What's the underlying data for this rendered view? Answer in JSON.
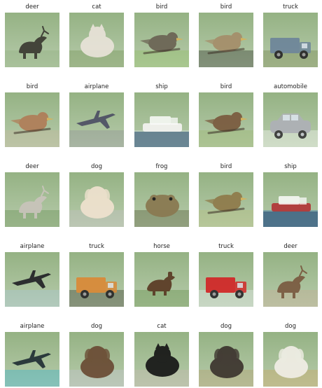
{
  "images": [
    {
      "label": "deer",
      "subject": "deer",
      "bg": "#8fae7d",
      "fg": "#3b3a32"
    },
    {
      "label": "cat",
      "subject": "cat",
      "bg": "#6f8f4c",
      "fg": "#e9e3d9"
    },
    {
      "label": "bird",
      "subject": "bird",
      "bg": "#8fbf5f",
      "fg": "#6b6354"
    },
    {
      "label": "bird",
      "subject": "bird",
      "bg": "#23251f",
      "fg": "#a58e6a"
    },
    {
      "label": "truck",
      "subject": "truck",
      "bg": "#6f7e42",
      "fg": "#6f879a"
    },
    {
      "label": "bird",
      "subject": "bird",
      "bg": "#c8b79e",
      "fg": "#b07d58"
    },
    {
      "label": "airplane",
      "subject": "airplane",
      "bg": "#8c8c95",
      "fg": "#4b4d63"
    },
    {
      "label": "ship",
      "subject": "ship",
      "bg": "#d6e2ea",
      "fg": "#f2f2ef"
    },
    {
      "label": "bird",
      "subject": "bird",
      "bg": "#9bb86a",
      "fg": "#7a5a3e"
    },
    {
      "label": "automobile",
      "subject": "automobile",
      "bg": "#ffffff",
      "fg": "#aeb1b6"
    },
    {
      "label": "deer",
      "subject": "deer",
      "bg": "#5e8a4a",
      "fg": "#c9c4bb"
    },
    {
      "label": "dog",
      "subject": "dog",
      "bg": "#c7c0c6",
      "fg": "#f0e2cf"
    },
    {
      "label": "frog",
      "subject": "frog",
      "bg": "#4c4f2e",
      "fg": "#8a7a52"
    },
    {
      "label": "bird",
      "subject": "bird",
      "bg": "#b7c07a",
      "fg": "#8f7a4a"
    },
    {
      "label": "ship",
      "subject": "ship",
      "bg": "#2f6fb2",
      "fg": "#b23a3a"
    },
    {
      "label": "airplane",
      "subject": "airplane",
      "bg": "#a9c9dd",
      "fg": "#1f1f24"
    },
    {
      "label": "truck",
      "subject": "truck",
      "bg": "#2e2a22",
      "fg": "#d98b3a"
    },
    {
      "label": "horse",
      "subject": "horse",
      "bg": "#5d8a3e",
      "fg": "#5a3a24"
    },
    {
      "label": "truck",
      "subject": "truck",
      "bg": "#e9eef3",
      "fg": "#d12a2a"
    },
    {
      "label": "deer",
      "subject": "deer",
      "bg": "#c9a892",
      "fg": "#7a5a40"
    },
    {
      "label": "airplane",
      "subject": "airplane",
      "bg": "#2bb3d3",
      "fg": "#1e2c33"
    },
    {
      "label": "dog",
      "subject": "dog",
      "bg": "#c7c2d3",
      "fg": "#6a4b34"
    },
    {
      "label": "cat",
      "subject": "cat",
      "bg": "#c9b6b2",
      "fg": "#161616"
    },
    {
      "label": "dog",
      "subject": "dog",
      "bg": "#b89b6a",
      "fg": "#3c342e"
    },
    {
      "label": "dog",
      "subject": "dog",
      "bg": "#d2a35c",
      "fg": "#f1eee6"
    }
  ]
}
